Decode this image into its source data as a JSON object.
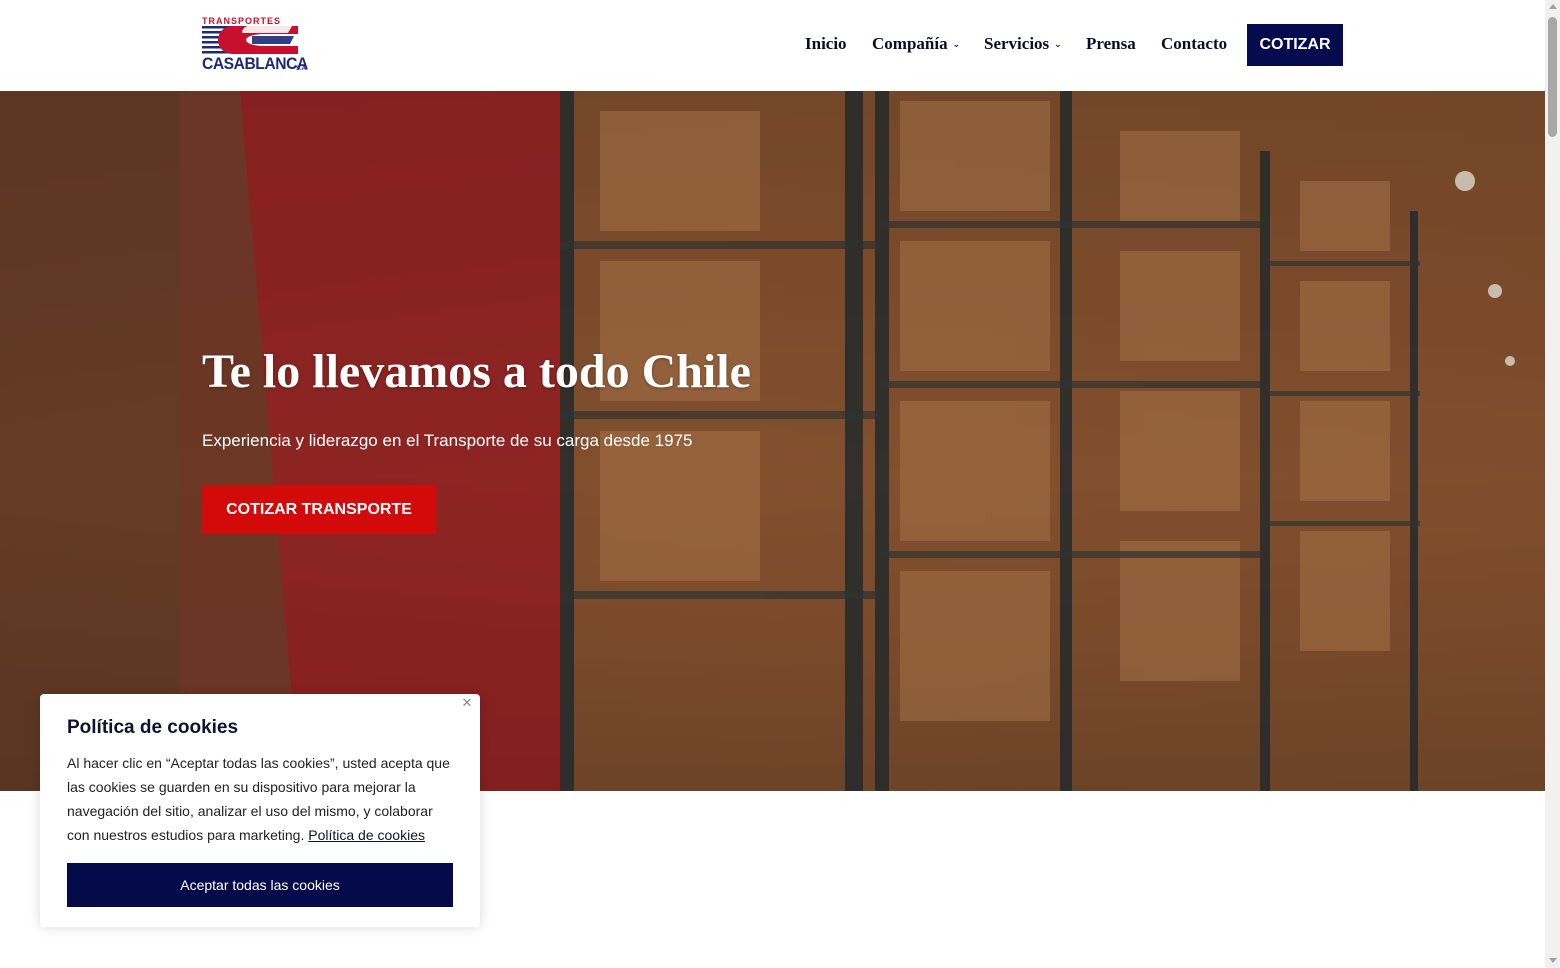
{
  "brand": {
    "logo_top": "TRANSPORTES",
    "logo_bottom": "CASABLANCA",
    "logo_suffix": "S.A.",
    "colors": {
      "navy": "#060b4e",
      "red": "#d20a0a",
      "logo_blue": "#1b2a7a",
      "logo_red": "#c8102e"
    }
  },
  "nav": {
    "items": [
      {
        "label": "Inicio",
        "has_dropdown": false
      },
      {
        "label": "Compañía",
        "has_dropdown": true
      },
      {
        "label": "Servicios",
        "has_dropdown": true
      },
      {
        "label": "Prensa",
        "has_dropdown": false
      },
      {
        "label": "Contacto",
        "has_dropdown": false
      }
    ],
    "dropdown_icon": "chevron-down-icon",
    "cta_label": "COTIZAR"
  },
  "hero": {
    "title": "Te lo llevamos a todo Chile",
    "subtitle": "Experiencia y liderazgo en el Transporte de su carga desde 1975",
    "cta_label": "COTIZAR TRANSPORTE",
    "image_subject": "warehouse-shelves-with-boxes"
  },
  "cookie": {
    "title": "Política de cookies",
    "body": "Al hacer clic en “Aceptar todas las cookies”, usted acepta que las cookies se guarden en su dispositivo para mejorar la navegación del sitio, analizar el uso del mismo, y colaborar con nuestros estudios para marketing.",
    "link_label": "Política de cookies",
    "accept_label": "Aceptar todas las cookies",
    "close_icon": "close-icon"
  }
}
